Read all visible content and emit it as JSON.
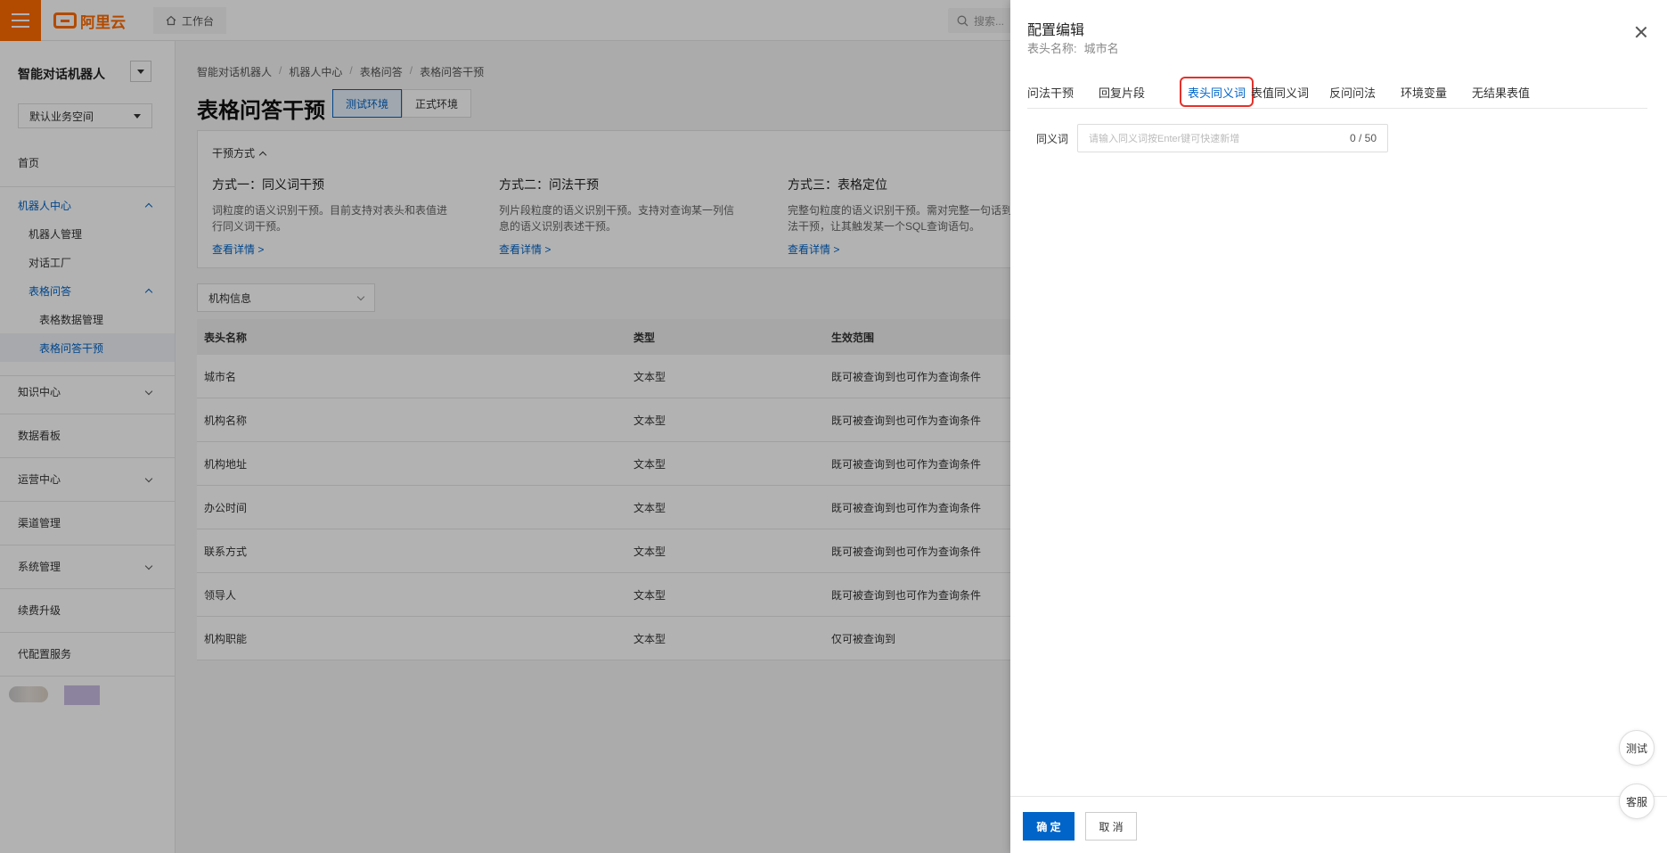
{
  "topbar": {
    "logo_text": "阿里云",
    "workbench": "工作台",
    "search_placeholder": "搜索..."
  },
  "sidebar": {
    "title": "智能对话机器人",
    "workspace": "默认业务空间",
    "items": [
      {
        "label": "首页"
      },
      {
        "label": "机器人中心"
      },
      {
        "label": "机器人管理"
      },
      {
        "label": "对话工厂"
      },
      {
        "label": "表格问答"
      },
      {
        "label": "表格数据管理"
      },
      {
        "label": "表格问答干预"
      },
      {
        "label": "知识中心"
      },
      {
        "label": "数据看板"
      },
      {
        "label": "运营中心"
      },
      {
        "label": "渠道管理"
      },
      {
        "label": "系统管理"
      },
      {
        "label": "续费升级"
      },
      {
        "label": "代配置服务"
      }
    ]
  },
  "main": {
    "breadcrumb": [
      "智能对话机器人",
      "机器人中心",
      "表格问答",
      "表格问答干预"
    ],
    "title": "表格问答干预",
    "env_tabs": [
      "测试环境",
      "正式环境"
    ],
    "panel": {
      "head": "干预方式",
      "methods": [
        {
          "title": "方式一：同义词干预",
          "desc": "词粒度的语义识别干预。目前支持对表头和表值进行同义词干预。",
          "link": "查看详情 >"
        },
        {
          "title": "方式二：问法干预",
          "desc": "列片段粒度的语义识别干预。支持对查询某一列信息的语义识别表述干预。",
          "link": "查看详情 >"
        },
        {
          "title": "方式三：表格定位",
          "desc": "完整句粒度的语义识别干预。需对完整一句话到问法干预，让其触发某一个SQL查询语句。",
          "link": "查看详情 >"
        }
      ]
    },
    "filter": "机构信息",
    "table": {
      "headers": [
        "表头名称",
        "类型",
        "生效范围"
      ],
      "rows": [
        [
          "城市名",
          "文本型",
          "既可被查询到也可作为查询条件"
        ],
        [
          "机构名称",
          "文本型",
          "既可被查询到也可作为查询条件"
        ],
        [
          "机构地址",
          "文本型",
          "既可被查询到也可作为查询条件"
        ],
        [
          "办公时间",
          "文本型",
          "既可被查询到也可作为查询条件"
        ],
        [
          "联系方式",
          "文本型",
          "既可被查询到也可作为查询条件"
        ],
        [
          "领导人",
          "文本型",
          "既可被查询到也可作为查询条件"
        ],
        [
          "机构职能",
          "文本型",
          "仅可被查询到"
        ]
      ]
    }
  },
  "drawer": {
    "title": "配置编辑",
    "sub_label": "表头名称:",
    "sub_value": "城市名",
    "tabs": [
      "问法干预",
      "回复片段",
      "表头同义词",
      "表值同义词",
      "反问问法",
      "环境变量",
      "无结果表值"
    ],
    "active_tab": "表头同义词",
    "synonym_label": "同义词",
    "synonym_placeholder": "请输入同义词按Enter键可快速新增",
    "synonym_count": "0 / 50",
    "ok": "确 定",
    "cancel": "取 消"
  },
  "float": {
    "test": "测试",
    "service": "客服"
  },
  "colors": {
    "brand": "#ff6a00",
    "primary": "#0064c8",
    "highlight": "#e4322b"
  }
}
